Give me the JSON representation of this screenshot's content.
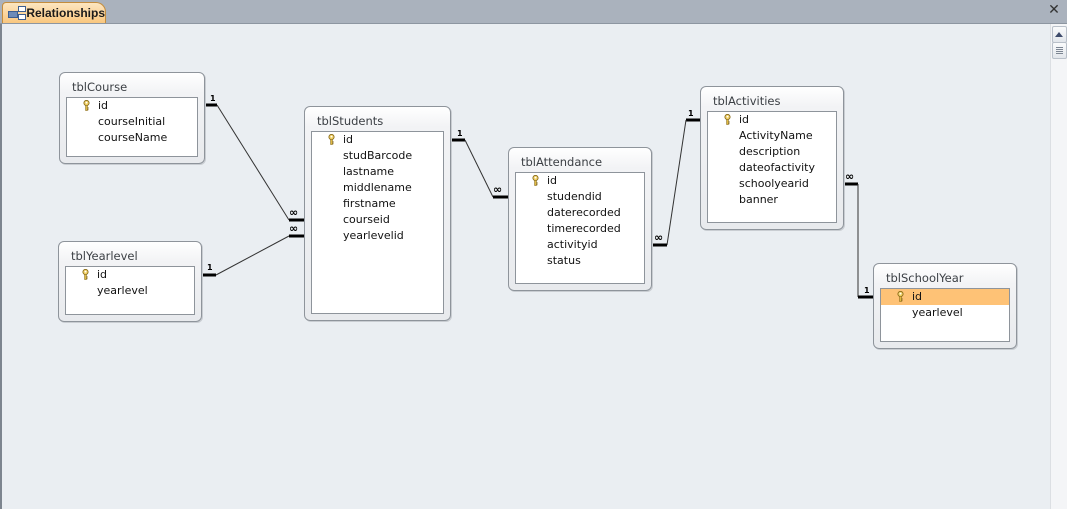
{
  "window": {
    "tab_label": "Relationships",
    "tab_icon": "relationships-icon",
    "close_icon": "close-icon"
  },
  "tables": [
    {
      "id": "tblCourse",
      "title": "tblCourse",
      "fields": [
        {
          "name": "id",
          "primary_key": true
        },
        {
          "name": "courseInitial",
          "primary_key": false
        },
        {
          "name": "courseName",
          "primary_key": false
        }
      ]
    },
    {
      "id": "tblYearlevel",
      "title": "tblYearlevel",
      "fields": [
        {
          "name": "id",
          "primary_key": true
        },
        {
          "name": "yearlevel",
          "primary_key": false
        }
      ]
    },
    {
      "id": "tblStudents",
      "title": "tblStudents",
      "fields": [
        {
          "name": "id",
          "primary_key": true
        },
        {
          "name": "studBarcode",
          "primary_key": false
        },
        {
          "name": "lastname",
          "primary_key": false
        },
        {
          "name": "middlename",
          "primary_key": false
        },
        {
          "name": "firstname",
          "primary_key": false
        },
        {
          "name": "courseid",
          "primary_key": false
        },
        {
          "name": "yearlevelid",
          "primary_key": false
        }
      ]
    },
    {
      "id": "tblAttendance",
      "title": "tblAttendance",
      "fields": [
        {
          "name": "id",
          "primary_key": true
        },
        {
          "name": "studendid",
          "primary_key": false
        },
        {
          "name": "daterecorded",
          "primary_key": false
        },
        {
          "name": "timerecorded",
          "primary_key": false
        },
        {
          "name": "activityid",
          "primary_key": false
        },
        {
          "name": "status",
          "primary_key": false
        }
      ]
    },
    {
      "id": "tblActivities",
      "title": "tblActivities",
      "fields": [
        {
          "name": "id",
          "primary_key": true
        },
        {
          "name": "ActivityName",
          "primary_key": false
        },
        {
          "name": "description",
          "primary_key": false
        },
        {
          "name": "dateofactivity",
          "primary_key": false
        },
        {
          "name": "schoolyearid",
          "primary_key": false
        },
        {
          "name": "banner",
          "primary_key": false
        }
      ]
    },
    {
      "id": "tblSchoolYear",
      "title": "tblSchoolYear",
      "fields": [
        {
          "name": "id",
          "primary_key": true,
          "selected": true
        },
        {
          "name": "yearlevel",
          "primary_key": false
        }
      ]
    }
  ],
  "relationships": [
    {
      "from_table": "tblCourse",
      "from_field": "id",
      "from_label": "1",
      "to_table": "tblStudents",
      "to_field": "courseid",
      "to_label": "∞"
    },
    {
      "from_table": "tblYearlevel",
      "from_field": "id",
      "from_label": "1",
      "to_table": "tblStudents",
      "to_field": "yearlevelid",
      "to_label": "∞"
    },
    {
      "from_table": "tblStudents",
      "from_field": "id",
      "from_label": "1",
      "to_table": "tblAttendance",
      "to_field": "studendid",
      "to_label": "∞"
    },
    {
      "from_table": "tblActivities",
      "from_field": "id",
      "from_label": "1",
      "to_table": "tblAttendance",
      "to_field": "activityid",
      "to_label": "∞"
    },
    {
      "from_table": "tblSchoolYear",
      "from_field": "id",
      "from_label": "1",
      "to_table": "tblActivities",
      "to_field": "schoolyearid",
      "to_label": "∞"
    }
  ]
}
